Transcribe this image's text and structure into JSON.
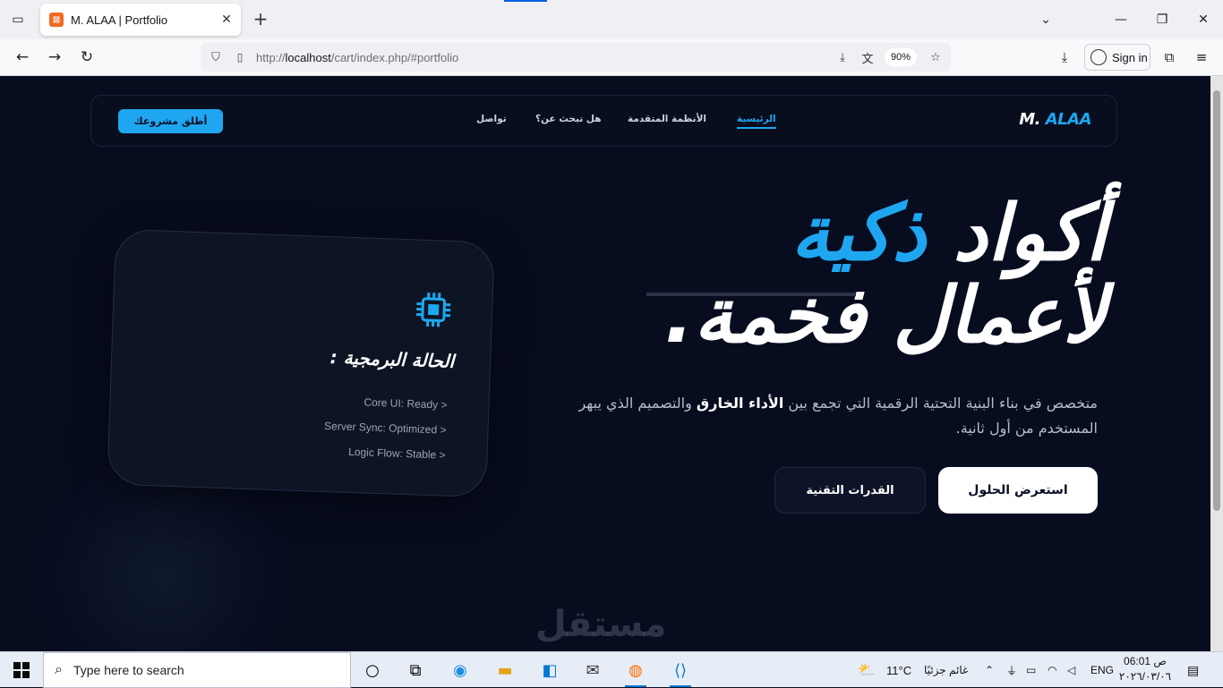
{
  "browser": {
    "tab_title": "M. ALAA | Portfolio",
    "url_prefix": "http://",
    "url_host": "localhost",
    "url_path": "/cart/index.php/#portfolio",
    "zoom": "90%",
    "signin_label": "Sign in"
  },
  "site": {
    "logo_main": "M.",
    "logo_accent": "ALAA",
    "cta_label": "أطلق مشروعك",
    "menu": [
      {
        "label": "الرئيسية",
        "active": true
      },
      {
        "label": "الأنظمة المتقدمة",
        "active": false
      },
      {
        "label": "هل تبحث عن؟",
        "active": false
      },
      {
        "label": "تواصل",
        "active": false
      }
    ],
    "hero": {
      "line1_word1": "أكواد",
      "line1_highlight": "ذكية",
      "line2": "لأعمال فخمة.",
      "desc_part1": "متخصص في بناء البنية التحتية الرقمية التي تجمع بين ",
      "desc_bold": "الأداء الخارق",
      "desc_part2": " والتصميم الذي يبهر المستخدم من أول ثانية.",
      "btn_primary": "استعرض الحلول",
      "btn_secondary": "القدرات التقنية"
    },
    "status_card": {
      "title": "الحالة البرمجية :",
      "lines": [
        "Core UI: Ready >",
        "Server Sync: Optimized >",
        "Logic Flow: Stable >"
      ]
    },
    "watermark": "مستقل"
  },
  "taskbar": {
    "search_placeholder": "Type here to search",
    "weather_temp": "11°C",
    "weather_text": "غائم جزئيًا",
    "language": "ENG",
    "time": "06:01 ص",
    "date": "٢٠٢٦/٠٣/٠٦"
  },
  "colors": {
    "accent": "#1ea7f0",
    "page_bg": "#070c1f"
  }
}
